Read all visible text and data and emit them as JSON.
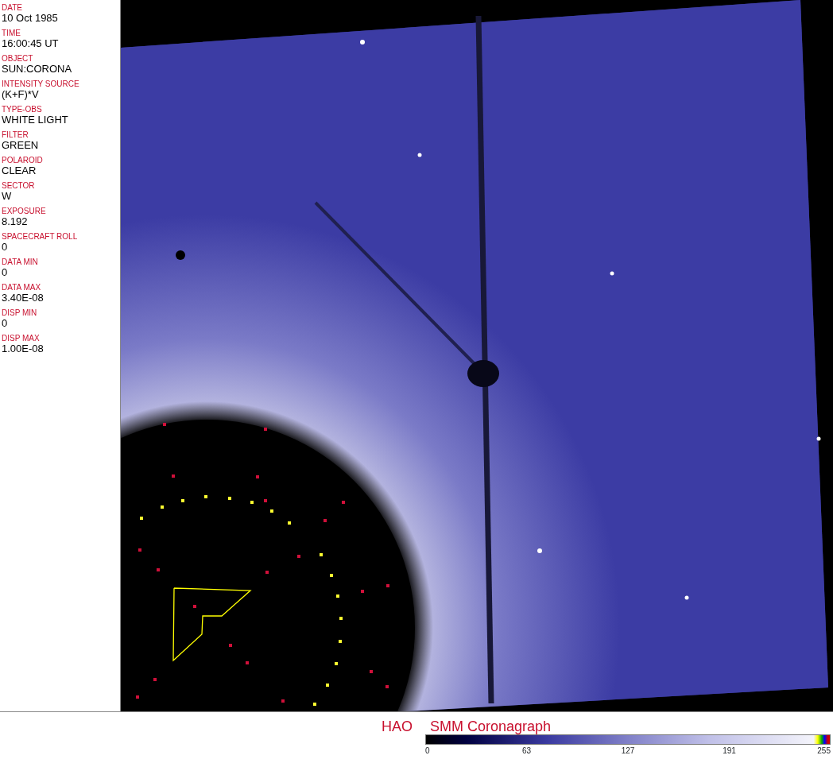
{
  "header_fields": [
    {
      "label": "DATE",
      "value": "10 Oct 1985"
    },
    {
      "label": "TIME",
      "value": "16:00:45 UT"
    },
    {
      "label": "OBJECT",
      "value": "SUN:CORONA"
    },
    {
      "label": "INTENSITY SOURCE",
      "value": "(K+F)*V"
    },
    {
      "label": "TYPE-OBS",
      "value": "WHITE LIGHT"
    },
    {
      "label": "FILTER",
      "value": "GREEN"
    },
    {
      "label": "POLAROID",
      "value": "CLEAR"
    },
    {
      "label": "SECTOR",
      "value": "W"
    },
    {
      "label": "EXPOSURE",
      "value": "8.192"
    },
    {
      "label": "SPACECRAFT ROLL",
      "value": "0"
    },
    {
      "label": "DATA MIN",
      "value": "0"
    },
    {
      "label": "DATA MAX",
      "value": "3.40E-08"
    },
    {
      "label": "DISP MIN",
      "value": "0"
    },
    {
      "label": "DISP MAX",
      "value": "1.00E-08"
    }
  ],
  "image_title": [
    "HAO",
    "SMM Coronagraph"
  ],
  "colorbar": {
    "tick_labels": [
      "0",
      "63",
      "127",
      "191",
      "255"
    ]
  }
}
